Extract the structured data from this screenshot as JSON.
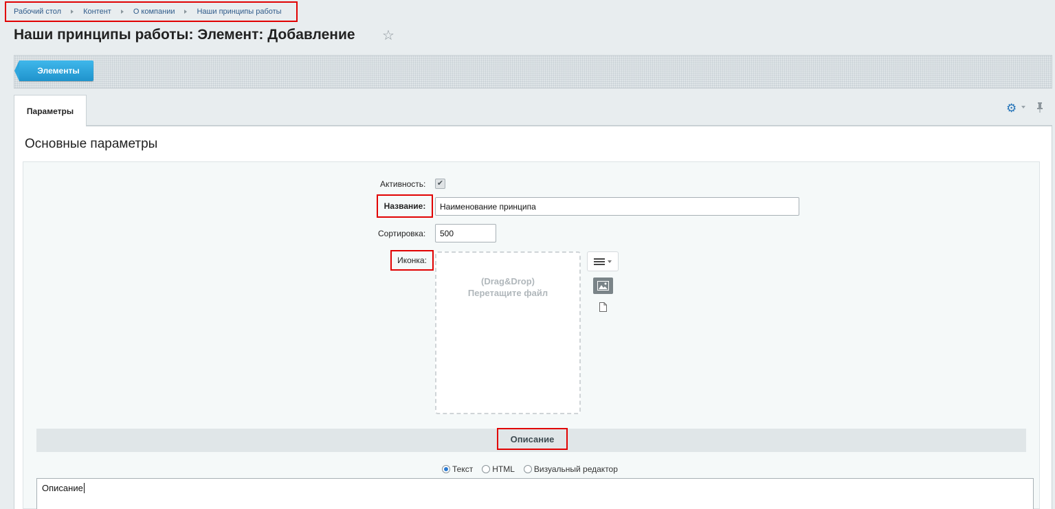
{
  "breadcrumb": [
    "Рабочий стол",
    "Контент",
    "О компании",
    "Наши принципы работы"
  ],
  "page_title": "Наши принципы работы: Элемент: Добавление",
  "toolbar": {
    "elements_button": "Элементы"
  },
  "tabs": [
    {
      "label": "Параметры",
      "active": true
    }
  ],
  "section_title": "Основные параметры",
  "form": {
    "active_label": "Активность:",
    "active_checked": true,
    "name_label": "Название:",
    "name_value": "Наименование принципа",
    "sort_label": "Сортировка:",
    "sort_value": "500",
    "icon_label": "Иконка:",
    "dropzone_line1": "(Drag&Drop)",
    "dropzone_line2": "Перетащите файл"
  },
  "description": {
    "title": "Описание",
    "modes": [
      "Текст",
      "HTML",
      "Визуальный редактор"
    ],
    "selected_mode": "Текст",
    "value": "Описание"
  },
  "colors": {
    "accent": "#1f93cc",
    "highlight": "#e10000",
    "link": "#2f5b8a"
  }
}
